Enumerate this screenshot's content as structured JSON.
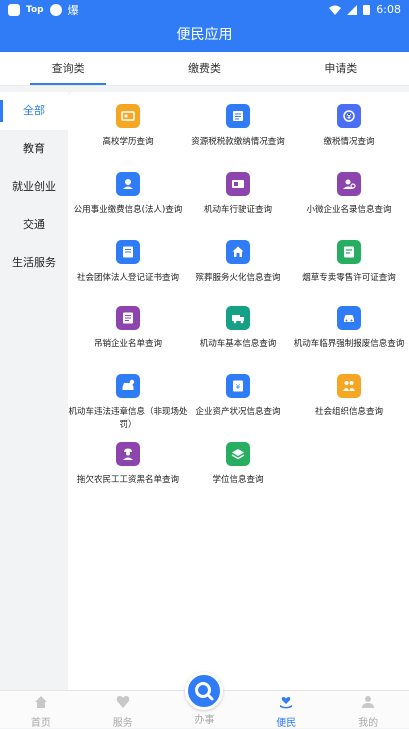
{
  "statusbar": {
    "app_tag": "Top",
    "glyph": "爆",
    "time": "6:08"
  },
  "header": {
    "title": "便民应用"
  },
  "tabs": [
    {
      "label": "查询类"
    },
    {
      "label": "缴费类"
    },
    {
      "label": "申请类"
    }
  ],
  "sidebar": [
    {
      "label": "全部"
    },
    {
      "label": "教育"
    },
    {
      "label": "就业创业"
    },
    {
      "label": "交通"
    },
    {
      "label": "生活服务"
    }
  ],
  "services": [
    {
      "label": "高校学历查询",
      "color": "#f5a623",
      "icon": "id-card-icon"
    },
    {
      "label": "资源税税款缴纳情况查询",
      "color": "#2f7cf6",
      "icon": "document-icon"
    },
    {
      "label": "缴税情况查询",
      "color": "#4c6ef5",
      "icon": "tax-icon"
    },
    {
      "label": "公用事业缴费信息(法人)查询",
      "color": "#2f7cf6",
      "icon": "utility-icon"
    },
    {
      "label": "机动车行驶证查询",
      "color": "#8e44ad",
      "icon": "license-icon"
    },
    {
      "label": "小微企业名录信息查询",
      "color": "#8e44ad",
      "icon": "enterprise-icon"
    },
    {
      "label": "社会团体法人登记证书查询",
      "color": "#2f7cf6",
      "icon": "certificate-icon"
    },
    {
      "label": "殡葬服务火化信息查询",
      "color": "#2f7cf6",
      "icon": "home-icon"
    },
    {
      "label": "烟草专卖零售许可证查询",
      "color": "#27ae60",
      "icon": "permit-icon"
    },
    {
      "label": "吊销企业名单查询",
      "color": "#8e44ad",
      "icon": "list-icon"
    },
    {
      "label": "机动车基本信息查询",
      "color": "#16a085",
      "icon": "truck-icon"
    },
    {
      "label": "机动车临界强制报废信息查询",
      "color": "#2f7cf6",
      "icon": "car-icon"
    },
    {
      "label": "机动车违法违章信息（非现场处罚）",
      "color": "#2f7cf6",
      "icon": "violation-icon"
    },
    {
      "label": "企业资产状况信息查询",
      "color": "#2f7cf6",
      "icon": "asset-icon"
    },
    {
      "label": "社会组织信息查询",
      "color": "#f5a623",
      "icon": "people-icon"
    },
    {
      "label": "拖欠农民工工资黑名单查询",
      "color": "#8e44ad",
      "icon": "worker-icon"
    },
    {
      "label": "学位信息查询",
      "color": "#27ae60",
      "icon": "layers-icon"
    }
  ],
  "nav": [
    {
      "label": "首页",
      "icon": "home-icon"
    },
    {
      "label": "服务",
      "icon": "heart-icon"
    },
    {
      "label": "办事",
      "icon": "search-icon"
    },
    {
      "label": "便民",
      "icon": "heart-hand-icon"
    },
    {
      "label": "我的",
      "icon": "user-icon"
    }
  ],
  "colors": {
    "primary": "#2f7cf6"
  }
}
